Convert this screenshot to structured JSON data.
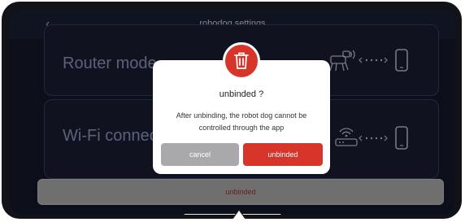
{
  "header": {
    "title": "robodog settings",
    "back_icon": "chevron-left-icon"
  },
  "modes": [
    {
      "label": "Router mode",
      "icon": "robot-dog-router-phone-icon"
    },
    {
      "label": "Wi-Fi connect",
      "icon": "router-phone-icon"
    }
  ],
  "dialog": {
    "icon": "trash-icon",
    "title": "unbinded ?",
    "message_line1": "After unbinding, the robot dog cannot be",
    "message_line2": "controlled through the app",
    "cancel_label": "cancel",
    "confirm_label": "unbinded"
  },
  "bottom_button": {
    "label": "unbinded"
  },
  "colors": {
    "accent": "#d8352a",
    "background": "#15182a",
    "mode_text": "#9aa3cf"
  }
}
